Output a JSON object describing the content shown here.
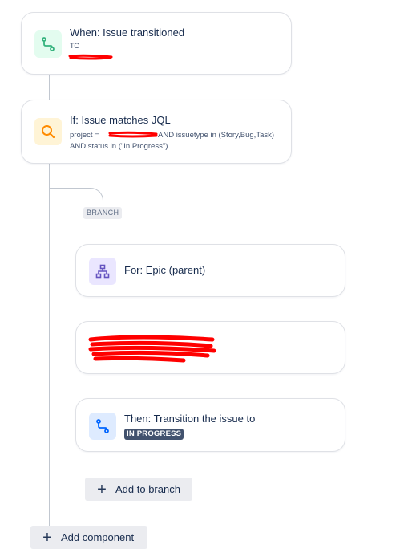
{
  "trigger": {
    "title": "When: Issue transitioned",
    "detail_label": "TO",
    "icon": "transition-icon"
  },
  "condition": {
    "title": "If: Issue matches JQL",
    "jql_line1_prefix": "project = ",
    "jql_line1_suffix": "AND issuetype in (Story,Bug,Task)",
    "jql_line2": "AND status in (\"In Progress\")",
    "icon": "search-icon"
  },
  "branch": {
    "tag": "BRANCH",
    "for_card": {
      "title": "For: Epic (parent)",
      "icon": "hierarchy-icon"
    },
    "action_card": {
      "title": "Then: Transition the issue to",
      "status": "IN PROGRESS",
      "icon": "transition-icon"
    },
    "add_to_branch_label": "Add to branch"
  },
  "add_component_label": "Add component",
  "colors": {
    "trigger_icon_bg": "#e3fcef",
    "trigger_icon": "#36b37e",
    "condition_icon_bg": "#fff4d6",
    "condition_icon": "#ff8b00",
    "branch_icon_bg": "#eae6ff",
    "branch_icon": "#6554c0",
    "action_icon_bg": "#deebff",
    "action_icon": "#0065ff",
    "redaction": "#ff0000",
    "status_lozenge": "#42526e"
  }
}
